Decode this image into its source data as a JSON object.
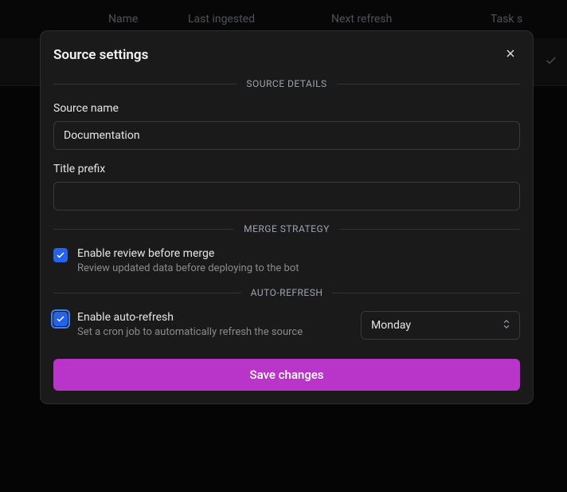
{
  "background": {
    "columns": [
      "Name",
      "Last ingested",
      "Next refresh",
      "Task s"
    ]
  },
  "modal": {
    "title": "Source settings",
    "sections": {
      "source_details": "SOURCE DETAILS",
      "merge_strategy": "MERGE STRATEGY",
      "auto_refresh": "AUTO-REFRESH"
    },
    "source_name": {
      "label": "Source name",
      "value": "Documentation"
    },
    "title_prefix": {
      "label": "Title prefix",
      "value": ""
    },
    "review_merge": {
      "title": "Enable review before merge",
      "desc": "Review updated data before deploying to the bot",
      "checked": true
    },
    "auto_refresh": {
      "title": "Enable auto-refresh",
      "desc": "Set a cron job to automatically refresh the source",
      "checked": true,
      "day": "Monday"
    },
    "save_label": "Save changes"
  }
}
